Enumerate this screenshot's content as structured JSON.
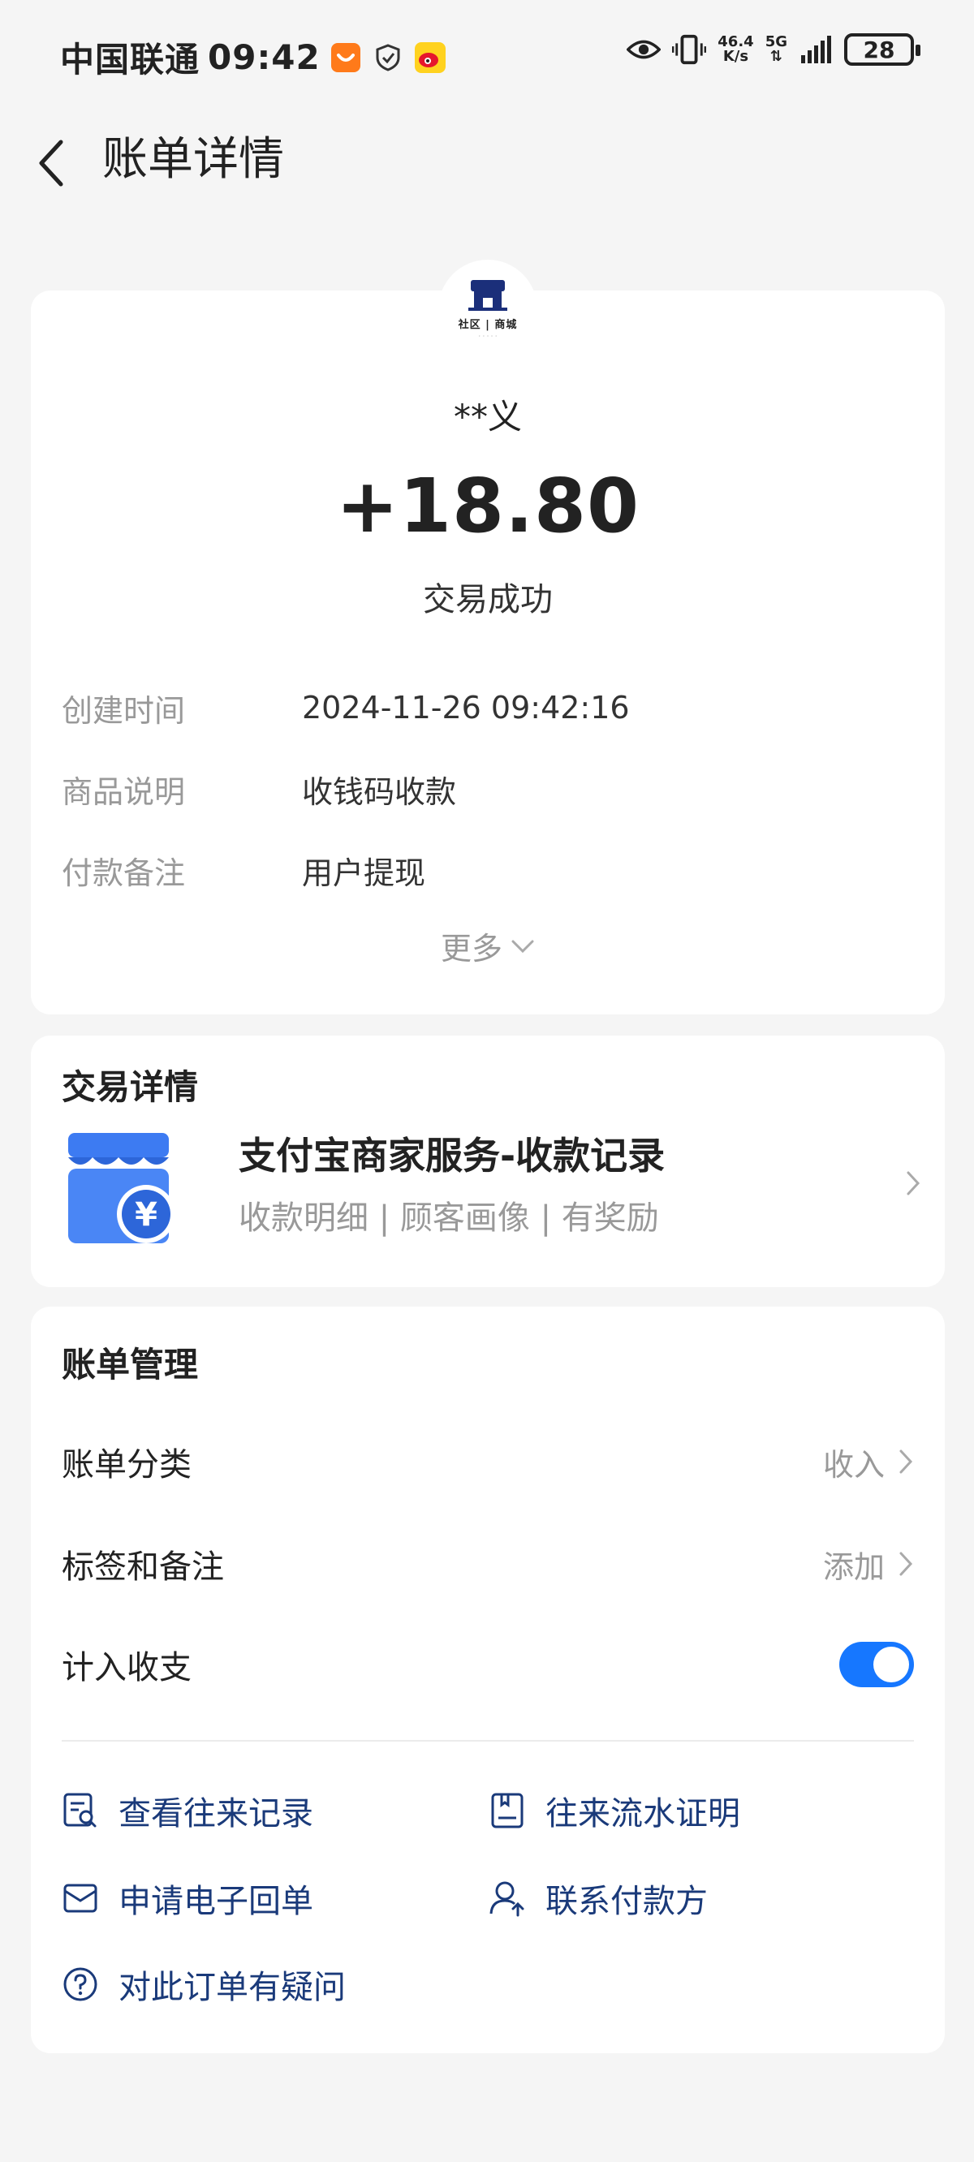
{
  "status_bar": {
    "carrier": "中国联通",
    "time": "09:42",
    "net_speed_top": "46.4",
    "net_speed_bottom": "K/s",
    "network": "5G",
    "battery": "28"
  },
  "header": {
    "title": "账单详情"
  },
  "summary": {
    "logo_text": "社区 | 商城",
    "payer": "**义",
    "amount": "+18.80",
    "status": "交易成功",
    "fields": [
      {
        "label": "创建时间",
        "value": "2024-11-26 09:42:16"
      },
      {
        "label": "商品说明",
        "value": "收钱码收款"
      },
      {
        "label": "付款备注",
        "value": "用户提现"
      }
    ],
    "more_label": "更多"
  },
  "transaction_detail": {
    "title": "交易详情",
    "service_title": "支付宝商家服务-收款记录",
    "service_sub": "收款明细 | 顾客画像 | 有奖励",
    "icon_glyph": "¥"
  },
  "bill_management": {
    "title": "账单管理",
    "category_label": "账单分类",
    "category_value": "收入",
    "tags_label": "标签和备注",
    "tags_value": "添加",
    "count_label": "计入收支",
    "count_enabled": true,
    "actions": {
      "history": "查看往来记录",
      "statement": "往来流水证明",
      "receipt": "申请电子回单",
      "contact": "联系付款方",
      "question": "对此订单有疑问"
    }
  },
  "colors": {
    "accent": "#1677ff",
    "link": "#1a3a7a",
    "background": "#f5f5f5"
  }
}
